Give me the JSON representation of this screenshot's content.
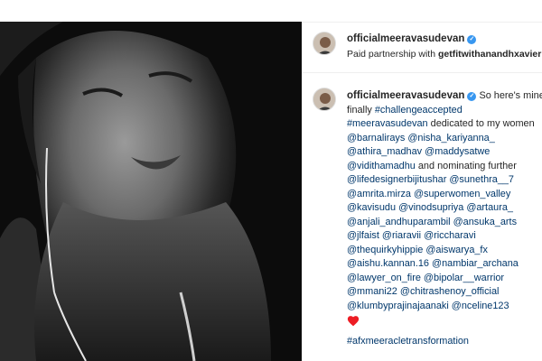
{
  "post": {
    "username": "officialmeeravasudevan",
    "verified_icon": "verified-badge-icon",
    "subtitle_prefix": "Paid partnership with",
    "partner": "getfitwithanandhxavier",
    "photo_description_icon": "post-photo",
    "caption": {
      "username": "officialmeeravasudevan",
      "lines": [
        {
          "text": "So here's",
          "kind": "plain"
        },
        {
          "text": "mine finally",
          "kind": "plain"
        },
        {
          "text": "#challengeaccepted",
          "kind": "tag"
        },
        {
          "text": "#meeravasudevan",
          "kind": "tag"
        },
        {
          "text": "dedicated to my",
          "kind": "plain"
        },
        {
          "text": "women",
          "kind": "plain"
        },
        {
          "text": "@barnalirays",
          "kind": "tag"
        },
        {
          "text": "@nisha_kariyanna_",
          "kind": "tag"
        },
        {
          "text": "@athira_madhav",
          "kind": "tag"
        },
        {
          "text": "@maddysatwe",
          "kind": "tag"
        },
        {
          "text": "@vidithamadhu",
          "kind": "tag"
        },
        {
          "text": "and",
          "kind": "plain"
        },
        {
          "text": "nominating further",
          "kind": "plain"
        },
        {
          "text": "@lifedesignerbijitushar",
          "kind": "tag"
        },
        {
          "text": "@sunethra__7",
          "kind": "tag"
        },
        {
          "text": "@amrita.mirza",
          "kind": "tag"
        },
        {
          "text": "@superwomen_valley",
          "kind": "tag"
        },
        {
          "text": "@kavisudu",
          "kind": "tag"
        },
        {
          "text": "@vinodsupriya",
          "kind": "tag"
        },
        {
          "text": "@artaura_",
          "kind": "tag"
        },
        {
          "text": "@anjali_andhuparambil",
          "kind": "tag"
        },
        {
          "text": "@ansuka_arts",
          "kind": "tag"
        },
        {
          "text": "@jlfaist",
          "kind": "tag"
        },
        {
          "text": "@riaravii",
          "kind": "tag"
        },
        {
          "text": "@riccharavi",
          "kind": "tag"
        },
        {
          "text": "@thequirkyhippie",
          "kind": "tag"
        },
        {
          "text": "@aiswarya_fx",
          "kind": "tag"
        },
        {
          "text": "@aishu.kannan.16",
          "kind": "tag"
        },
        {
          "text": "@nambiar_archana",
          "kind": "tag"
        },
        {
          "text": "@lawyer_on_fire",
          "kind": "tag"
        },
        {
          "text": "@bipolar__warrior",
          "kind": "tag"
        },
        {
          "text": "@mmani22",
          "kind": "tag"
        },
        {
          "text": "@chitrashenoy_official",
          "kind": "tag"
        },
        {
          "text": "@klumbyprajinajaanaki",
          "kind": "tag"
        },
        {
          "text": "@nceline123",
          "kind": "tag"
        }
      ],
      "heart_icon": "red-heart-icon",
      "final_tag": "#afxmeeracletransformation"
    }
  },
  "colors": {
    "link": "#00376b",
    "verified": "#3897f0",
    "heart": "#ed1c24",
    "text": "#262626",
    "photo_bg": "#0c0c0c"
  }
}
